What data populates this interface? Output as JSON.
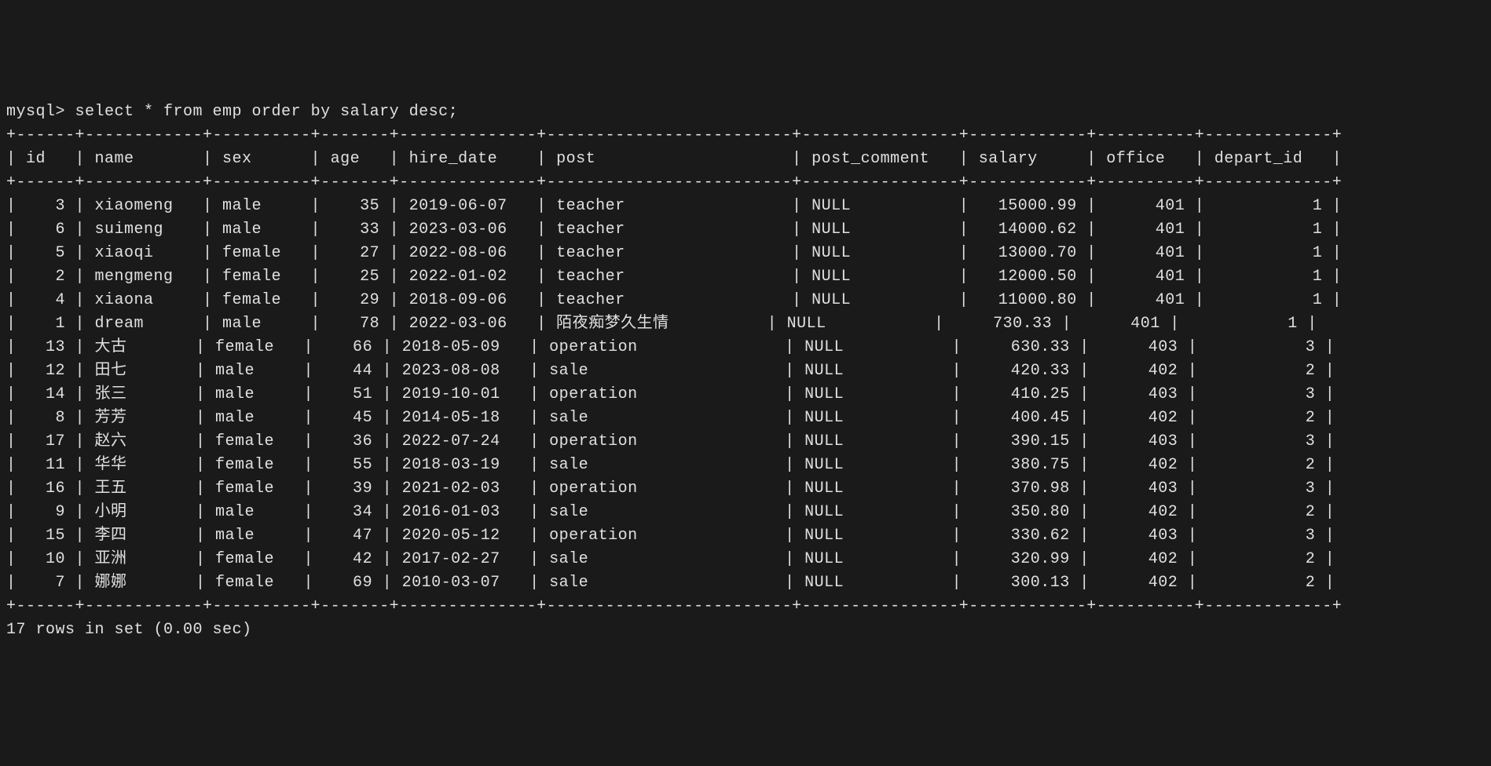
{
  "prompt": "mysql> ",
  "query": "select * from emp order by salary desc;",
  "columns": [
    "id",
    "name",
    "sex",
    "age",
    "hire_date",
    "post",
    "post_comment",
    "salary",
    "office",
    "depart_id"
  ],
  "rows": [
    {
      "id": 3,
      "name": "xiaomeng",
      "sex": "male",
      "age": 35,
      "hire_date": "2019-06-07",
      "post": "teacher",
      "post_comment": "NULL",
      "salary": "15000.99",
      "office": 401,
      "depart_id": 1
    },
    {
      "id": 6,
      "name": "suimeng",
      "sex": "male",
      "age": 33,
      "hire_date": "2023-03-06",
      "post": "teacher",
      "post_comment": "NULL",
      "salary": "14000.62",
      "office": 401,
      "depart_id": 1
    },
    {
      "id": 5,
      "name": "xiaoqi",
      "sex": "female",
      "age": 27,
      "hire_date": "2022-08-06",
      "post": "teacher",
      "post_comment": "NULL",
      "salary": "13000.70",
      "office": 401,
      "depart_id": 1
    },
    {
      "id": 2,
      "name": "mengmeng",
      "sex": "female",
      "age": 25,
      "hire_date": "2022-01-02",
      "post": "teacher",
      "post_comment": "NULL",
      "salary": "12000.50",
      "office": 401,
      "depart_id": 1
    },
    {
      "id": 4,
      "name": "xiaona",
      "sex": "female",
      "age": 29,
      "hire_date": "2018-09-06",
      "post": "teacher",
      "post_comment": "NULL",
      "salary": "11000.80",
      "office": 401,
      "depart_id": 1
    },
    {
      "id": 1,
      "name": "dream",
      "sex": "male",
      "age": 78,
      "hire_date": "2022-03-06",
      "post": "陌夜痴梦久生情",
      "post_comment": "NULL",
      "salary": "730.33",
      "office": 401,
      "depart_id": 1
    },
    {
      "id": 13,
      "name": "大古",
      "sex": "female",
      "age": 66,
      "hire_date": "2018-05-09",
      "post": "operation",
      "post_comment": "NULL",
      "salary": "630.33",
      "office": 403,
      "depart_id": 3
    },
    {
      "id": 12,
      "name": "田七",
      "sex": "male",
      "age": 44,
      "hire_date": "2023-08-08",
      "post": "sale",
      "post_comment": "NULL",
      "salary": "420.33",
      "office": 402,
      "depart_id": 2
    },
    {
      "id": 14,
      "name": "张三",
      "sex": "male",
      "age": 51,
      "hire_date": "2019-10-01",
      "post": "operation",
      "post_comment": "NULL",
      "salary": "410.25",
      "office": 403,
      "depart_id": 3
    },
    {
      "id": 8,
      "name": "芳芳",
      "sex": "male",
      "age": 45,
      "hire_date": "2014-05-18",
      "post": "sale",
      "post_comment": "NULL",
      "salary": "400.45",
      "office": 402,
      "depart_id": 2
    },
    {
      "id": 17,
      "name": "赵六",
      "sex": "female",
      "age": 36,
      "hire_date": "2022-07-24",
      "post": "operation",
      "post_comment": "NULL",
      "salary": "390.15",
      "office": 403,
      "depart_id": 3
    },
    {
      "id": 11,
      "name": "华华",
      "sex": "female",
      "age": 55,
      "hire_date": "2018-03-19",
      "post": "sale",
      "post_comment": "NULL",
      "salary": "380.75",
      "office": 402,
      "depart_id": 2
    },
    {
      "id": 16,
      "name": "王五",
      "sex": "female",
      "age": 39,
      "hire_date": "2021-02-03",
      "post": "operation",
      "post_comment": "NULL",
      "salary": "370.98",
      "office": 403,
      "depart_id": 3
    },
    {
      "id": 9,
      "name": "小明",
      "sex": "male",
      "age": 34,
      "hire_date": "2016-01-03",
      "post": "sale",
      "post_comment": "NULL",
      "salary": "350.80",
      "office": 402,
      "depart_id": 2
    },
    {
      "id": 15,
      "name": "李四",
      "sex": "male",
      "age": 47,
      "hire_date": "2020-05-12",
      "post": "operation",
      "post_comment": "NULL",
      "salary": "330.62",
      "office": 403,
      "depart_id": 3
    },
    {
      "id": 10,
      "name": "亚洲",
      "sex": "female",
      "age": 42,
      "hire_date": "2017-02-27",
      "post": "sale",
      "post_comment": "NULL",
      "salary": "320.99",
      "office": 402,
      "depart_id": 2
    },
    {
      "id": 7,
      "name": "娜娜",
      "sex": "female",
      "age": 69,
      "hire_date": "2010-03-07",
      "post": "sale",
      "post_comment": "NULL",
      "salary": "300.13",
      "office": 402,
      "depart_id": 2
    }
  ],
  "footer": "17 rows in set (0.00 sec)",
  "widths": {
    "id": 4,
    "name": 10,
    "sex": 8,
    "age": 5,
    "hire_date": 12,
    "post": 23,
    "post_comment": 14,
    "salary": 10,
    "office": 8,
    "depart_id": 11
  }
}
